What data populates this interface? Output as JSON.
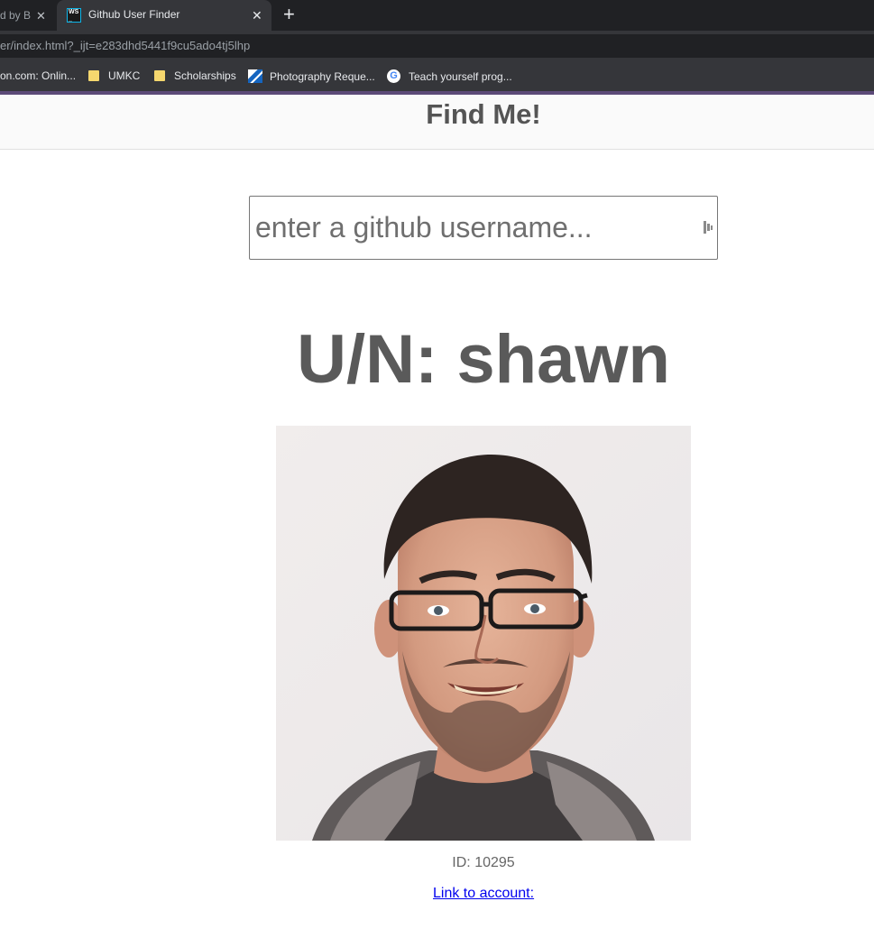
{
  "browser": {
    "tabs": [
      {
        "title": "d by B",
        "active": false
      },
      {
        "title": "Github User Finder",
        "active": true
      }
    ],
    "address": "er/index.html?_ijt=e283dhd5441f9cu5ado4tj5lhp",
    "bookmarks": [
      {
        "label": "on.com: Onlin...",
        "icon": "none"
      },
      {
        "label": "UMKC",
        "icon": "folder-icon"
      },
      {
        "label": "Scholarships",
        "icon": "folder-icon"
      },
      {
        "label": "Photography Reque...",
        "icon": "photo-icon"
      },
      {
        "label": "Teach yourself prog...",
        "icon": "google-icon"
      }
    ]
  },
  "page": {
    "title": "Find Me!",
    "search": {
      "placeholder": "enter a github username...",
      "value": ""
    },
    "username_heading": "U/N: shawn",
    "user_id": "ID: 10295",
    "account_link": "Link to account:"
  },
  "colors": {
    "heading": "#5a5a5a",
    "link": "#0000ee",
    "tabstrip": "#202124",
    "toolbar": "#35363a"
  }
}
